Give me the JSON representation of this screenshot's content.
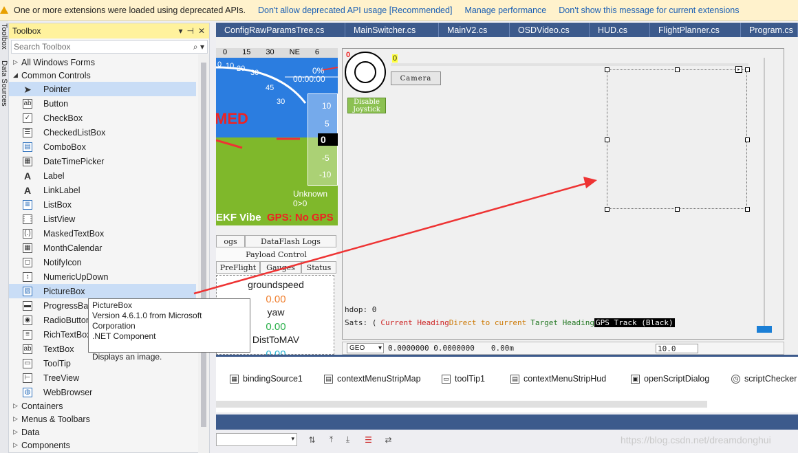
{
  "infobar": {
    "message": "One or more extensions were loaded using deprecated APIs.",
    "links": [
      "Don't allow deprecated API usage [Recommended]",
      "Manage performance",
      "Don't show this message for current extensions"
    ]
  },
  "side_strip": {
    "tabs": [
      "Toolbox",
      "Data Sources"
    ]
  },
  "toolbox": {
    "title": "Toolbox",
    "title_buttons": [
      "▾",
      "⊣",
      "✕"
    ],
    "search_placeholder": "Search Toolbox",
    "search_icon": "search-icon",
    "categories_top": [
      {
        "label": "All Windows Forms",
        "expanded": false
      },
      {
        "label": "Common Controls",
        "expanded": true
      }
    ],
    "items": [
      {
        "label": "Pointer",
        "icon": "pointer-icon",
        "glyph": "➤"
      },
      {
        "label": "Button",
        "icon": "button-icon",
        "glyph": "ab"
      },
      {
        "label": "CheckBox",
        "icon": "checkbox-icon",
        "glyph": "✓"
      },
      {
        "label": "CheckedListBox",
        "icon": "checkedlistbox-icon",
        "glyph": "☰"
      },
      {
        "label": "ComboBox",
        "icon": "combobox-icon",
        "glyph": "▤"
      },
      {
        "label": "DateTimePicker",
        "icon": "datetimepicker-icon",
        "glyph": "▦"
      },
      {
        "label": "Label",
        "icon": "label-icon",
        "glyph": "A"
      },
      {
        "label": "LinkLabel",
        "icon": "linklabel-icon",
        "glyph": "A"
      },
      {
        "label": "ListBox",
        "icon": "listbox-icon",
        "glyph": "≣"
      },
      {
        "label": "ListView",
        "icon": "listview-icon",
        "glyph": "⋮⋮"
      },
      {
        "label": "MaskedTextBox",
        "icon": "maskedtextbox-icon",
        "glyph": "(.)"
      },
      {
        "label": "MonthCalendar",
        "icon": "monthcalendar-icon",
        "glyph": "▦"
      },
      {
        "label": "NotifyIcon",
        "icon": "notifyicon-icon",
        "glyph": "◻"
      },
      {
        "label": "NumericUpDown",
        "icon": "numericupdown-icon",
        "glyph": "↕"
      },
      {
        "label": "PictureBox",
        "icon": "picturebox-icon",
        "glyph": "▨"
      },
      {
        "label": "ProgressBar",
        "icon": "progressbar-icon",
        "glyph": "▬"
      },
      {
        "label": "RadioButton",
        "icon": "radiobutton-icon",
        "glyph": "◉"
      },
      {
        "label": "RichTextBox",
        "icon": "richtextbox-icon",
        "glyph": "≡"
      },
      {
        "label": "TextBox",
        "icon": "textbox-icon",
        "glyph": "ab"
      },
      {
        "label": "ToolTip",
        "icon": "tooltip-icon",
        "glyph": "▭"
      },
      {
        "label": "TreeView",
        "icon": "treeview-icon",
        "glyph": "⊢"
      },
      {
        "label": "WebBrowser",
        "icon": "webbrowser-icon",
        "glyph": "◍"
      }
    ],
    "selected_index": 14,
    "categories_bottom": [
      {
        "label": "Containers"
      },
      {
        "label": "Menus & Toolbars"
      },
      {
        "label": "Data"
      },
      {
        "label": "Components"
      }
    ]
  },
  "tooltip": {
    "title": "PictureBox",
    "line1": "Version 4.6.1.0 from Microsoft Corporation",
    "line2": ".NET Component",
    "line3": "Displays an image."
  },
  "doc_tabs": [
    "ConfigRawParamsTree.cs",
    "MainSwitcher.cs",
    "MainV2.cs",
    "OSDVideo.cs",
    "HUD.cs",
    "FlightPlanner.cs",
    "Program.cs"
  ],
  "hud": {
    "compass": [
      "0",
      "15",
      "30",
      "NE",
      "6"
    ],
    "speed_marks": [
      "0",
      "10",
      "20",
      "30",
      "45",
      "30"
    ],
    "distance": "00:00:00",
    "percent": "0%",
    "armed_text": "MED",
    "alt_scale": [
      "10",
      "5",
      "-5",
      "-10"
    ],
    "alt_value": "0",
    "status_line1": "Unknown",
    "status_line2": "0>0",
    "ekf_vibe": "EKF Vibe",
    "gps": "GPS: No GPS"
  },
  "hud_tabs": {
    "row1": [
      "ogs",
      "DataFlash Logs"
    ],
    "row2": [
      "Payload Control"
    ],
    "row3": [
      "PreFlight",
      "Gauges",
      "Status"
    ]
  },
  "gauges": [
    {
      "label": "groundspeed",
      "value": "0.00"
    },
    {
      "label": "yaw",
      "value": "0.00"
    },
    {
      "label": "DistToMAV",
      "value": "0.00"
    }
  ],
  "main_pane": {
    "red_zero": "0",
    "yellow_zero": "0",
    "camera_label": "Camera",
    "joystick_label": "Disable Joystick",
    "hdop": "hdop: 0",
    "sats_prefix": "Sats: (",
    "current_heading": "Current Heading",
    "direct_to_current": "Direct to current",
    "target_heading": "Target Heading",
    "gps_track": "GPS Track (Black)",
    "geo_label": "GEO",
    "coords": "0.0000000 0.0000000",
    "alt_coord": "0.00m",
    "zoom_value": "10.0"
  },
  "component_tray": [
    {
      "label": "bindingSource1",
      "icon": "bindingsource-icon"
    },
    {
      "label": "contextMenuStripMap",
      "icon": "contextmenu-icon"
    },
    {
      "label": "toolTip1",
      "icon": "tooltip-icon"
    },
    {
      "label": "contextMenuStripHud",
      "icon": "contextmenu-icon"
    },
    {
      "label": "openScriptDialog",
      "icon": "openfiledialog-icon"
    },
    {
      "label": "scriptChecker",
      "icon": "timer-icon"
    }
  ],
  "watermark": "https://blog.csdn.net/dreamdonghui",
  "colors": {
    "infobar_bg": "#fff2cc",
    "link": "#1a5fb4",
    "title_highlight": "#fff29d",
    "selection": "#c9ddf6",
    "tab_bar": "#3c5a8c",
    "gps_red": "#ee2222",
    "arrow_red": "#ee3333",
    "current_heading": "#cc2222",
    "direct_to": "#cc7700",
    "target_heading": "#227722"
  }
}
